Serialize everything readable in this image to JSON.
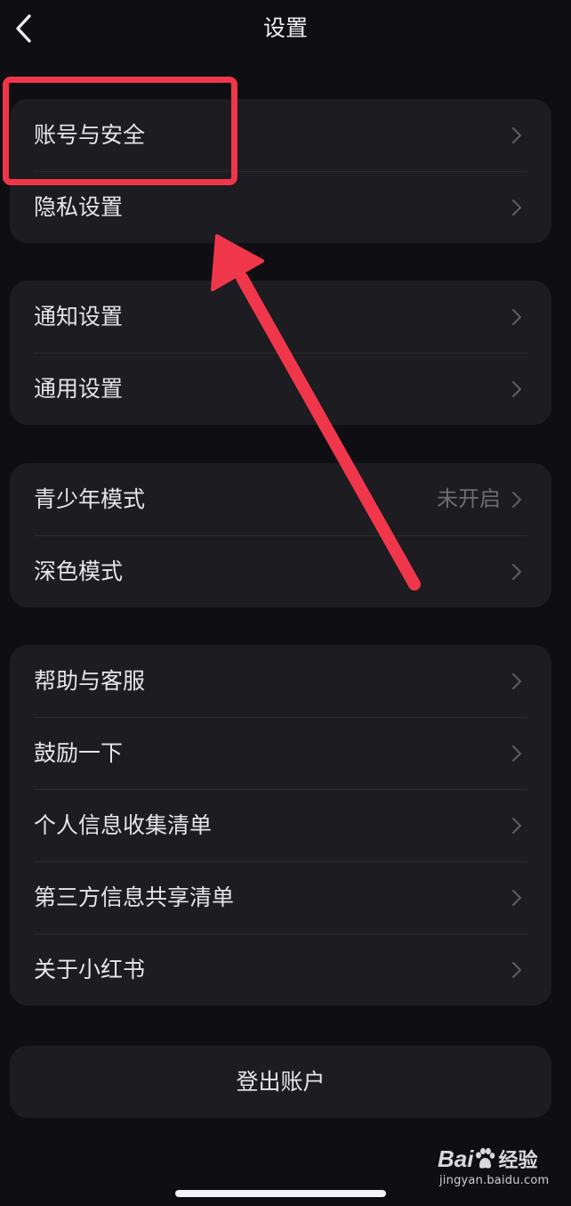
{
  "header": {
    "title": "设置"
  },
  "groups": [
    {
      "rows": [
        {
          "label": "账号与安全",
          "value": ""
        },
        {
          "label": "隐私设置",
          "value": ""
        }
      ]
    },
    {
      "rows": [
        {
          "label": "通知设置",
          "value": ""
        },
        {
          "label": "通用设置",
          "value": ""
        }
      ]
    },
    {
      "rows": [
        {
          "label": "青少年模式",
          "value": "未开启"
        },
        {
          "label": "深色模式",
          "value": ""
        }
      ]
    },
    {
      "rows": [
        {
          "label": "帮助与客服",
          "value": ""
        },
        {
          "label": "鼓励一下",
          "value": ""
        },
        {
          "label": "个人信息收集清单",
          "value": ""
        },
        {
          "label": "第三方信息共享清单",
          "value": ""
        },
        {
          "label": "关于小红书",
          "value": ""
        }
      ]
    }
  ],
  "logout": {
    "label": "登出账户"
  },
  "annotation": {
    "color": "#f0364b",
    "highlighted_item": "账号与安全"
  },
  "watermark": {
    "logo_text": "Bai",
    "logo_cn": "经验",
    "url": "jingyan.baidu.com"
  },
  "icons": {
    "back": "chevron-left-icon",
    "row_arrow": "chevron-right-icon",
    "watermark_paw": "baidu-paw-icon"
  },
  "colors": {
    "background": "#0f0f13",
    "card": "#1c1c21",
    "text": "#e6e6e9",
    "secondary_text": "#6d6d74"
  }
}
